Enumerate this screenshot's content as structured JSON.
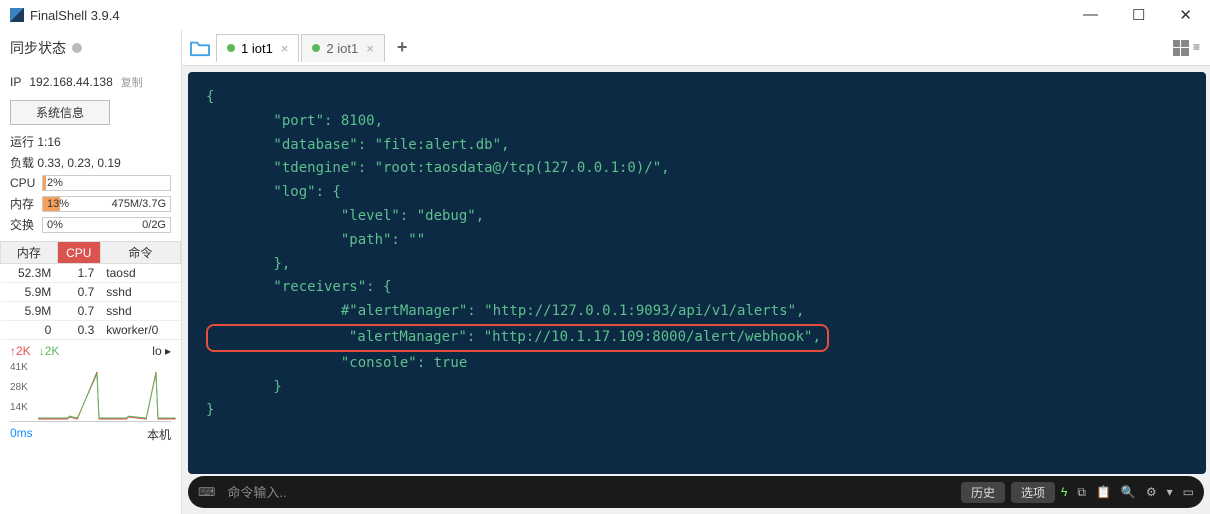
{
  "titlebar": {
    "title": "FinalShell 3.9.4"
  },
  "sidebar": {
    "sync_label": "同步状态",
    "ip_label": "IP",
    "ip_value": "192.168.44.138",
    "copy": "复制",
    "sysinfo_btn": "系统信息",
    "uptime": "运行 1:16",
    "load": "负载 0.33, 0.23, 0.19",
    "cpu_label": "CPU",
    "cpu_pct": "2%",
    "mem_label": "内存",
    "mem_pct": "13%",
    "mem_text": "475M/3.7G",
    "swap_label": "交换",
    "swap_pct": "0%",
    "swap_text": "0/2G",
    "proc_headers": {
      "mem": "内存",
      "cpu": "CPU",
      "cmd": "命令"
    },
    "procs": [
      {
        "mem": "52.3M",
        "cpu": "1.7",
        "cmd": "taosd"
      },
      {
        "mem": "5.9M",
        "cpu": "0.7",
        "cmd": "sshd"
      },
      {
        "mem": "5.9M",
        "cpu": "0.7",
        "cmd": "sshd"
      },
      {
        "mem": "0",
        "cpu": "0.3",
        "cmd": "kworker/0"
      }
    ],
    "net_up": "↑2K",
    "net_dn": "↓2K",
    "net_iface": "lo",
    "y_labels": [
      "41K",
      "28K",
      "14K"
    ],
    "latency": "0ms",
    "local": "本机"
  },
  "tabs": [
    {
      "label": "1 iot1",
      "active": true
    },
    {
      "label": "2 iot1",
      "active": false
    }
  ],
  "terminal": {
    "lines": [
      "{",
      "        \"port\": 8100,",
      "        \"database\": \"file:alert.db\",",
      "        \"tdengine\": \"root:taosdata@/tcp(127.0.0.1:0)/\",",
      "        \"log\": {",
      "                \"level\": \"debug\",",
      "                \"path\": \"\"",
      "        },",
      "        \"receivers\": {",
      "                #\"alertManager\": \"http://127.0.0.1:9093/api/v1/alerts\",",
      "HL:                \"alertManager\": \"http://10.1.17.109:8000/alert/webhook\",",
      "                \"console\": true",
      "        }",
      "}"
    ]
  },
  "cmdbar": {
    "placeholder": "命令输入..",
    "history": "历史",
    "options": "选项"
  }
}
